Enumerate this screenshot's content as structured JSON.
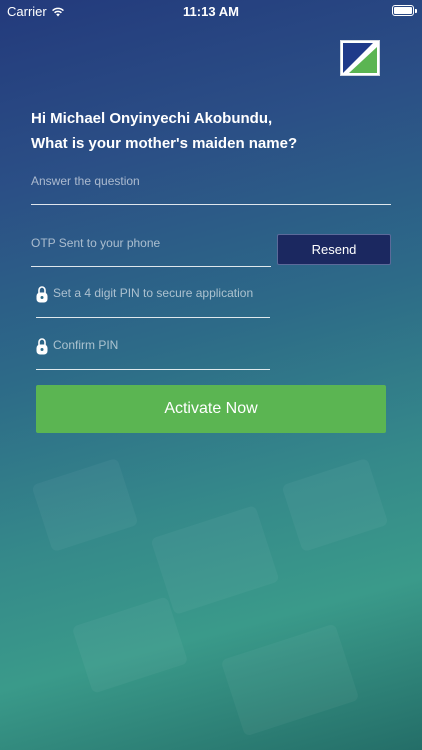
{
  "status_bar": {
    "carrier": "Carrier",
    "time": "11:13 AM",
    "wifi_icon": "wifi-icon",
    "battery_icon": "battery-icon"
  },
  "logo": {
    "icon": "bank-logo-icon",
    "colors": [
      "#1f3a8a",
      "#5bb552"
    ]
  },
  "greeting": "Hi Michael Onyinyechi Akobundu,",
  "security_question": "What is your mother's maiden name?",
  "form": {
    "answer": {
      "placeholder": "Answer the question",
      "value": ""
    },
    "otp": {
      "placeholder": "OTP Sent to your phone",
      "value": ""
    },
    "resend_label": "Resend",
    "pin": {
      "placeholder": "Set a 4 digit PIN to secure application",
      "value": "",
      "icon": "lock-icon"
    },
    "confirm_pin": {
      "placeholder": "Confirm PIN",
      "value": "",
      "icon": "lock-icon"
    },
    "activate_label": "Activate Now"
  },
  "colors": {
    "accent_green": "#5bb552",
    "button_navy": "#1b2860"
  }
}
